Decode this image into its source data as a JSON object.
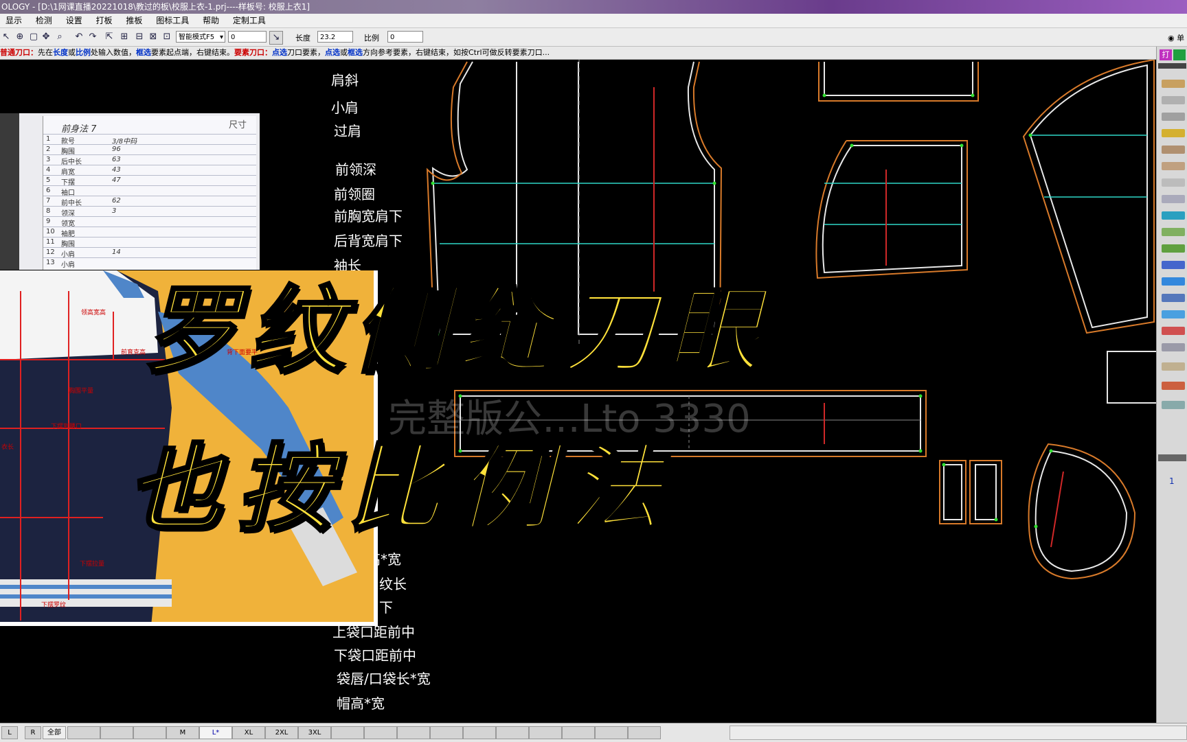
{
  "window": {
    "title": "OLOGY - [D:\\1网课直播20221018\\教过的板\\校服上衣-1.prj----样板号: 校服上衣1]"
  },
  "menu": [
    "显示",
    "检测",
    "设置",
    "打板",
    "推板",
    "图标工具",
    "帮助",
    "定制工具"
  ],
  "toolbar": {
    "mode_select": "智能模式F5",
    "field1": "0",
    "length_label": "长度",
    "length_value": "23.2",
    "ratio_label": "比例",
    "ratio_value": "0",
    "right_option": "单"
  },
  "hint": {
    "p1": "普通刀口：",
    "p2": "先在",
    "p3": "长度",
    "p4": "或",
    "p5": "比例",
    "p6": "处输入数值，",
    "p7": "框选",
    "p8": "要素起点端，右键结束。",
    "p9": "要素刀口：",
    "p10": "点选",
    "p11": "刀口要素，",
    "p12": "点选",
    "p13": "或",
    "p14": "框选",
    "p15": "方向参考要素，右键结束，如按Ctrl可做反转要素刀口..."
  },
  "measure_labels": [
    "肩斜",
    "小肩",
    "过肩",
    "前领深",
    "前领圈",
    "前胸宽肩下",
    "后背宽肩下",
    "袖长"
  ],
  "measure_labels_bottom": [
    "高*宽",
    "纹长",
    "下",
    "上袋口距前中",
    "下袋口距前中",
    "袋唇/口袋长*宽",
    "帽高*宽"
  ],
  "watermark": "完整版公…Lto 3330",
  "overlay": {
    "line1": "罗纹侧缝刀眼",
    "line2": "也按比例法"
  },
  "photo1": {
    "header": "前身法 7",
    "header_right": "尺寸",
    "rows": [
      {
        "n": "1",
        "name": "款号",
        "val": "3/8中码"
      },
      {
        "n": "2",
        "name": "胸围",
        "val": "96"
      },
      {
        "n": "3",
        "name": "后中长",
        "val": "63"
      },
      {
        "n": "4",
        "name": "肩宽",
        "val": "43"
      },
      {
        "n": "5",
        "name": "下摆",
        "val": "47"
      },
      {
        "n": "6",
        "name": "袖口",
        "val": ""
      },
      {
        "n": "7",
        "name": "前中长",
        "val": "62"
      },
      {
        "n": "8",
        "name": "领深",
        "val": "3"
      },
      {
        "n": "9",
        "name": "领宽",
        "val": ""
      },
      {
        "n": "10",
        "name": "袖肥",
        "val": ""
      },
      {
        "n": "11",
        "name": "胸围",
        "val": ""
      },
      {
        "n": "12",
        "name": "小肩",
        "val": "14"
      },
      {
        "n": "13",
        "name": "小肩",
        "val": ""
      }
    ]
  },
  "photo2_labels": [
    "领高宽高",
    "前育克高",
    "背下面要平",
    "胸围平量",
    "下摆到腰口",
    "衣长",
    "下摆拉量",
    "下摆罗纹"
  ],
  "statusbar": {
    "btn_l": "L",
    "btn_r": "R",
    "btn_all": "全部",
    "sizes": [
      "M",
      "L*",
      "XL",
      "2XL",
      "3XL"
    ]
  },
  "side_page_number": "1",
  "colors": {
    "pattern_line": "#e8e8e8",
    "seam_line": "#d87a2a",
    "guide_line": "#2fd7c8",
    "grainline": "#d02828",
    "point": "#32e032",
    "overlay_text": "#ffe13a"
  }
}
